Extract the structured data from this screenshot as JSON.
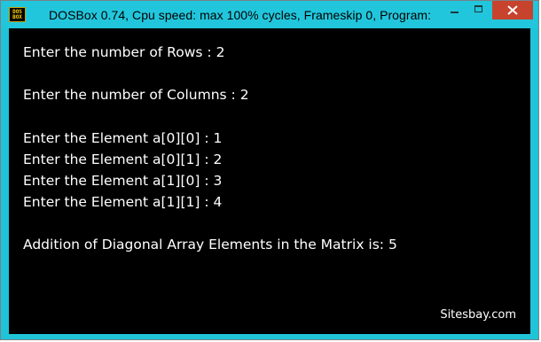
{
  "window": {
    "title": "DOSBox 0.74, Cpu speed: max 100% cycles, Frameskip  0, Program:",
    "icon_text_top": "DOS",
    "icon_text_bottom": "BOX",
    "icon_name": "dosbox-icon",
    "controls": {
      "minimize": "minimize-icon",
      "maximize": "maximize-icon",
      "close": "close-icon"
    },
    "colors": {
      "frame": "#22c6dc",
      "close_button": "#c7432e",
      "console_bg": "#000000",
      "console_text": "#ffffff"
    }
  },
  "console": {
    "lines": [
      "Enter the number of Rows : 2",
      "Enter the number of Columns : 2",
      "Enter the Element a[0][0] : 1",
      "Enter the Element a[0][1] : 2",
      "Enter the Element a[1][0] : 3",
      "Enter the Element a[1][1] : 4",
      "Addition of Diagonal Array Elements in the Matrix is: 5"
    ],
    "watermark": "Sitesbay.com"
  }
}
